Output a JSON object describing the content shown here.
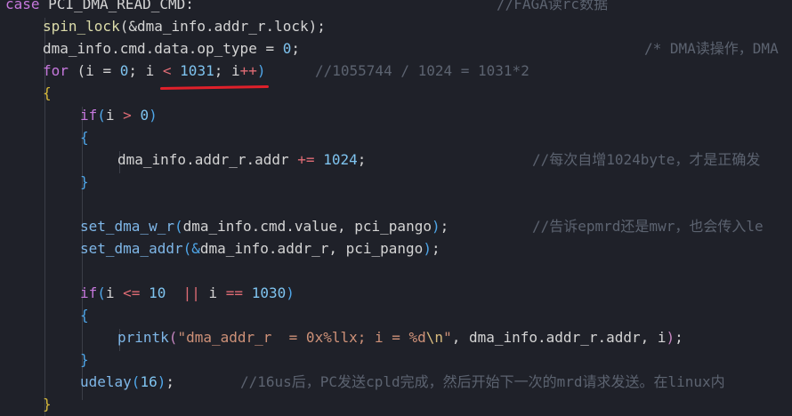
{
  "editor": {
    "lines": [
      {
        "id": "l0",
        "tokens": [
          {
            "t": "case ",
            "c": "kw"
          },
          {
            "t": "PCI_DMA_READ_CMD",
            "c": "var"
          },
          {
            "t": ":",
            "c": "op"
          }
        ],
        "comment": "//FAGA读rc数据"
      },
      {
        "id": "l1",
        "tokens": [
          {
            "t": "spin_lock",
            "c": "fn"
          },
          {
            "t": "(&",
            "c": "op"
          },
          {
            "t": "dma_info.addr_r.lock",
            "c": "var"
          },
          {
            "t": ");",
            "c": "op"
          }
        ]
      },
      {
        "id": "l2",
        "tokens": [
          {
            "t": "dma_info.cmd.data.op_type ",
            "c": "var"
          },
          {
            "t": "=",
            "c": "op"
          },
          {
            "t": " ",
            "c": "op"
          },
          {
            "t": "0",
            "c": "num2"
          },
          {
            "t": ";",
            "c": "op"
          }
        ],
        "comment": "/* DMA读操作，DMA"
      },
      {
        "id": "l3",
        "tokens": [
          {
            "t": "for",
            "c": "kw"
          },
          {
            "t": " (",
            "c": "op"
          },
          {
            "t": "i ",
            "c": "var"
          },
          {
            "t": "=",
            "c": "op"
          },
          {
            "t": " ",
            "c": "op"
          },
          {
            "t": "0",
            "c": "num2"
          },
          {
            "t": "; ",
            "c": "op"
          },
          {
            "t": "i ",
            "c": "var"
          },
          {
            "t": "<",
            "c": "opr"
          },
          {
            "t": " ",
            "c": "op"
          },
          {
            "t": "1031",
            "c": "num2"
          },
          {
            "t": "; ",
            "c": "op"
          },
          {
            "t": "i",
            "c": "var"
          },
          {
            "t": "++",
            "c": "opr"
          },
          {
            "t": ")",
            "c": "brace2"
          }
        ],
        "comment": "//1055744 / 1024 = 1031*2"
      },
      {
        "id": "l4",
        "tokens": [
          {
            "t": "{",
            "c": "brace1"
          }
        ]
      },
      {
        "id": "l5",
        "tokens": [
          {
            "t": "if",
            "c": "kw"
          },
          {
            "t": "(",
            "c": "brace2"
          },
          {
            "t": "i ",
            "c": "var"
          },
          {
            "t": ">",
            "c": "opr"
          },
          {
            "t": " ",
            "c": "op"
          },
          {
            "t": "0",
            "c": "num2"
          },
          {
            "t": ")",
            "c": "brace2"
          }
        ]
      },
      {
        "id": "l6",
        "tokens": [
          {
            "t": "{",
            "c": "brace2"
          }
        ]
      },
      {
        "id": "l7",
        "tokens": [
          {
            "t": "dma_info.addr_r.addr ",
            "c": "var"
          },
          {
            "t": "+=",
            "c": "opr"
          },
          {
            "t": " ",
            "c": "op"
          },
          {
            "t": "1024",
            "c": "num2"
          },
          {
            "t": ";",
            "c": "op"
          }
        ],
        "comment": "//每次自增1024byte，才是正确发"
      },
      {
        "id": "l8",
        "tokens": [
          {
            "t": "}",
            "c": "brace2"
          }
        ]
      },
      {
        "id": "l9",
        "tokens": []
      },
      {
        "id": "l10",
        "tokens": [
          {
            "t": "set_dma_w_r",
            "c": "fn2"
          },
          {
            "t": "(",
            "c": "brace2"
          },
          {
            "t": "dma_info.cmd.value, pci_pango",
            "c": "var"
          },
          {
            "t": ")",
            "c": "brace2"
          },
          {
            "t": ";",
            "c": "op"
          }
        ],
        "comment": "//告诉epmrd还是mwr，也会传入le"
      },
      {
        "id": "l11",
        "tokens": [
          {
            "t": "set_dma_addr",
            "c": "fn2"
          },
          {
            "t": "(&",
            "c": "brace2"
          },
          {
            "t": "dma_info.addr_r, pci_pango",
            "c": "var"
          },
          {
            "t": ")",
            "c": "brace2"
          },
          {
            "t": ";",
            "c": "op"
          }
        ]
      },
      {
        "id": "l12",
        "tokens": []
      },
      {
        "id": "l13",
        "tokens": [
          {
            "t": "if",
            "c": "kw"
          },
          {
            "t": "(",
            "c": "brace2"
          },
          {
            "t": "i ",
            "c": "var"
          },
          {
            "t": "<=",
            "c": "opr"
          },
          {
            "t": " ",
            "c": "op"
          },
          {
            "t": "10",
            "c": "num2"
          },
          {
            "t": "  ",
            "c": "op"
          },
          {
            "t": "||",
            "c": "opr"
          },
          {
            "t": " ",
            "c": "op"
          },
          {
            "t": "i ",
            "c": "var"
          },
          {
            "t": "==",
            "c": "opr"
          },
          {
            "t": " ",
            "c": "op"
          },
          {
            "t": "1030",
            "c": "num2"
          },
          {
            "t": ")",
            "c": "brace2"
          }
        ]
      },
      {
        "id": "l14",
        "tokens": [
          {
            "t": "{",
            "c": "brace2"
          }
        ]
      },
      {
        "id": "l15",
        "tokens": [
          {
            "t": "printk",
            "c": "fn2"
          },
          {
            "t": "(",
            "c": "brace3"
          },
          {
            "t": "\"dma_addr_r  = 0x%llx; i = %d",
            "c": "str"
          },
          {
            "t": "\\n",
            "c": "esc"
          },
          {
            "t": "\"",
            "c": "str"
          },
          {
            "t": ", dma_info.addr_r.addr, i",
            "c": "var"
          },
          {
            "t": ")",
            "c": "brace3"
          },
          {
            "t": ";",
            "c": "op"
          }
        ]
      },
      {
        "id": "l16",
        "tokens": [
          {
            "t": "}",
            "c": "brace2"
          }
        ]
      },
      {
        "id": "l17",
        "tokens": [
          {
            "t": "udelay",
            "c": "fn2"
          },
          {
            "t": "(",
            "c": "brace2"
          },
          {
            "t": "16",
            "c": "num2"
          },
          {
            "t": ")",
            "c": "brace2"
          },
          {
            "t": ";",
            "c": "op"
          }
        ],
        "comment": "//16us后，PC发送cpld完成，然后开始下一次的mrd请求发送。在linux内"
      },
      {
        "id": "l18",
        "tokens": [
          {
            "t": "}",
            "c": "brace1"
          }
        ]
      }
    ]
  },
  "colors": {
    "background": "#1f2129",
    "annotation_underline": "#e0202a"
  }
}
